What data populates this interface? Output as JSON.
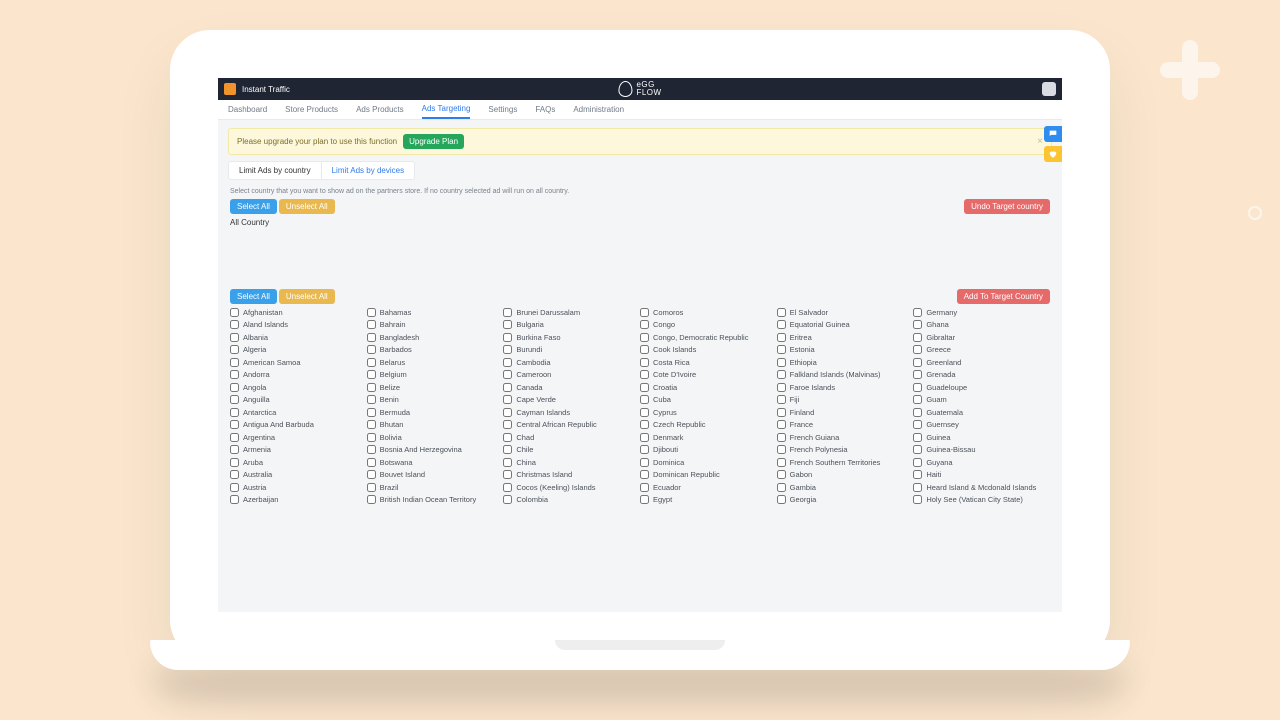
{
  "brand": {
    "app_name": "Instant Traffic",
    "logo_text": "eGG\nFLOW"
  },
  "nav": {
    "items": [
      {
        "label": "Dashboard"
      },
      {
        "label": "Store Products"
      },
      {
        "label": "Ads Products"
      },
      {
        "label": "Ads Targeting",
        "active": true
      },
      {
        "label": "Settings"
      },
      {
        "label": "FAQs"
      },
      {
        "label": "Administration"
      }
    ]
  },
  "alert": {
    "text": "Please upgrade your plan to use this function",
    "button": "Upgrade Plan"
  },
  "subtabs": {
    "active": "Limit Ads by country",
    "other": "Limit Ads by devices"
  },
  "help_text": "Select country that you want to show ad on the partners store. If no country selected ad will run on all country.",
  "buttons": {
    "select_all": "Select All",
    "unselect_all": "Unselect All",
    "undo_target": "Undo Target country",
    "add_target": "Add To Target Country"
  },
  "all_country_label": "All Country",
  "countries": [
    "Afghanistan",
    "Aland Islands",
    "Albania",
    "Algeria",
    "American Samoa",
    "Andorra",
    "Angola",
    "Anguilla",
    "Antarctica",
    "Antigua And Barbuda",
    "Argentina",
    "Armenia",
    "Aruba",
    "Australia",
    "Austria",
    "Azerbaijan",
    "Bahamas",
    "Bahrain",
    "Bangladesh",
    "Barbados",
    "Belarus",
    "Belgium",
    "Belize",
    "Benin",
    "Bermuda",
    "Bhutan",
    "Bolivia",
    "Bosnia And Herzegovina",
    "Botswana",
    "Bouvet Island",
    "Brazil",
    "British Indian Ocean Territory",
    "Brunei Darussalam",
    "Bulgaria",
    "Burkina Faso",
    "Burundi",
    "Cambodia",
    "Cameroon",
    "Canada",
    "Cape Verde",
    "Cayman Islands",
    "Central African Republic",
    "Chad",
    "Chile",
    "China",
    "Christmas Island",
    "Cocos (Keeling) Islands",
    "Colombia",
    "Comoros",
    "Congo",
    "Congo, Democratic Republic",
    "Cook Islands",
    "Costa Rica",
    "Cote D'Ivoire",
    "Croatia",
    "Cuba",
    "Cyprus",
    "Czech Republic",
    "Denmark",
    "Djibouti",
    "Dominica",
    "Dominican Republic",
    "Ecuador",
    "Egypt",
    "El Salvador",
    "Equatorial Guinea",
    "Eritrea",
    "Estonia",
    "Ethiopia",
    "Falkland Islands (Malvinas)",
    "Faroe Islands",
    "Fiji",
    "Finland",
    "France",
    "French Guiana",
    "French Polynesia",
    "French Southern Territories",
    "Gabon",
    "Gambia",
    "Georgia",
    "Germany",
    "Ghana",
    "Gibraltar",
    "Greece",
    "Greenland",
    "Grenada",
    "Guadeloupe",
    "Guam",
    "Guatemala",
    "Guernsey",
    "Guinea",
    "Guinea-Bissau",
    "Guyana",
    "Haiti",
    "Heard Island & Mcdonald Islands",
    "Holy See (Vatican City State)"
  ]
}
